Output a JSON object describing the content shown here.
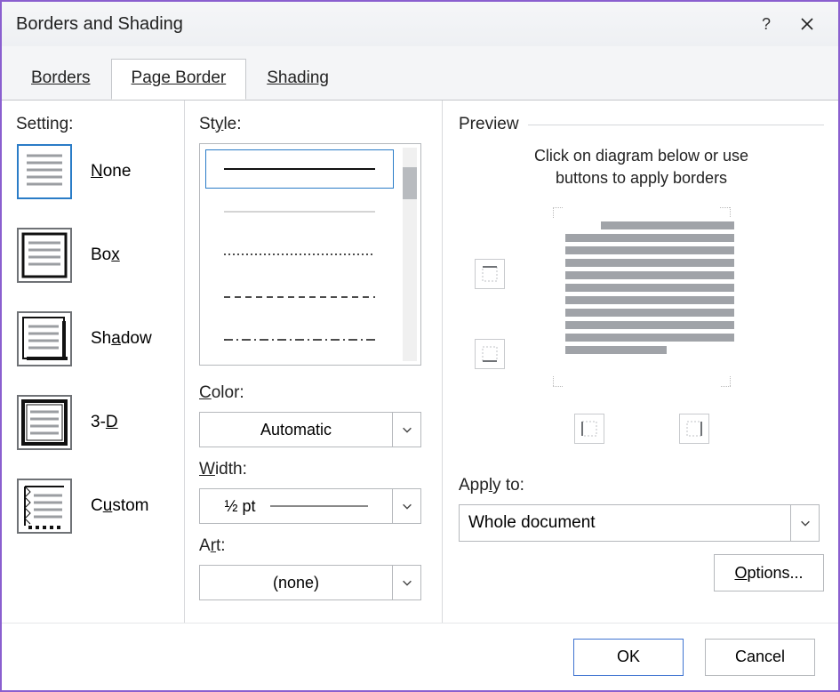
{
  "window": {
    "title": "Borders and Shading"
  },
  "tabs": {
    "borders": "Borders",
    "page_border": "Page Border",
    "shading": "Shading"
  },
  "labels": {
    "setting": "Setting:",
    "style": "Style:",
    "color": "Color:",
    "width": "Width:",
    "art": "Art:",
    "preview": "Preview",
    "apply_to": "Apply to:"
  },
  "settings": {
    "none": "None",
    "box": "Box",
    "shadow": "Shadow",
    "threeD": "3-D",
    "custom": "Custom"
  },
  "combos": {
    "color_value": "Automatic",
    "width_value": "½ pt",
    "art_value": "(none)",
    "apply_to_value": "Whole document"
  },
  "preview_hint_line1": "Click on diagram below or use",
  "preview_hint_line2": "buttons to apply borders",
  "buttons": {
    "options": "Options...",
    "ok": "OK",
    "cancel": "Cancel"
  }
}
